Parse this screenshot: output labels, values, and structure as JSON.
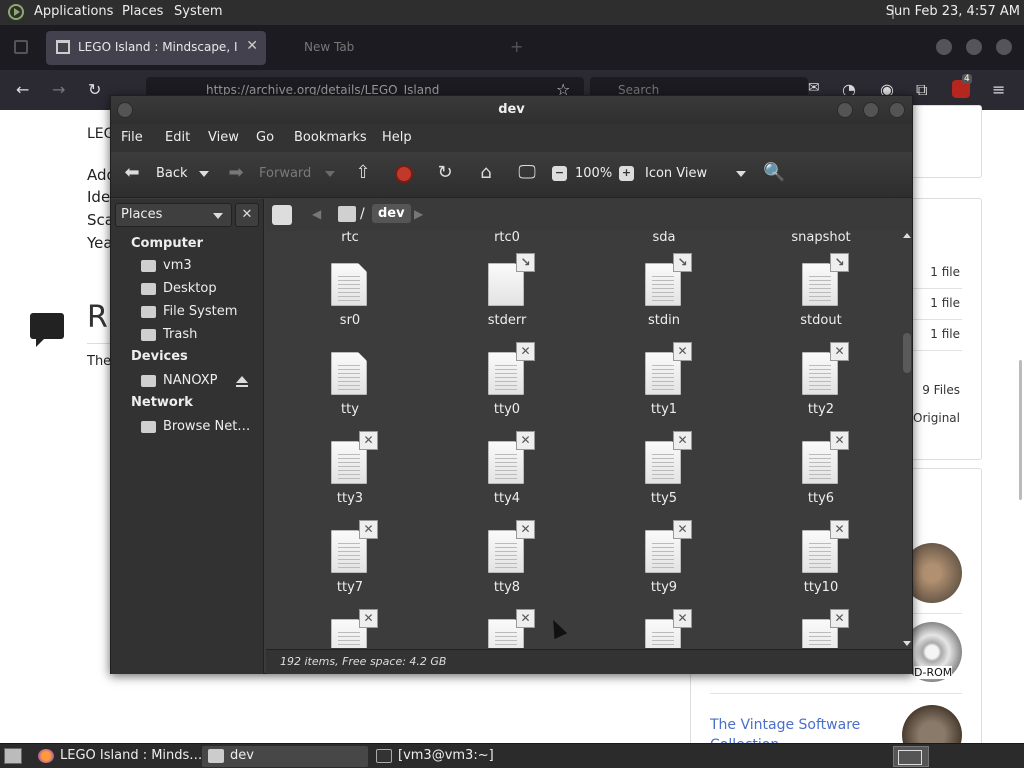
{
  "top_panel": {
    "menus": [
      "Applications",
      "Places",
      "System"
    ],
    "clock": "Sun Feb 23,  4:57 AM"
  },
  "browser": {
    "active_tab_title": "LEGO Island : Mindscape, In",
    "ghost_tab_title": "New Tab",
    "url": "https://archive.org/details/LEGO_Island",
    "search_placeholder": "Search",
    "extension_badge": "4",
    "page_left_texts": [
      "LEGO",
      "Add",
      "Ide",
      "Sca",
      "Yea"
    ],
    "page_heading_fragment": "R",
    "page_body_fragment": "The",
    "file_counts": [
      "1 file",
      "1 file",
      "1 file",
      "9 Files"
    ],
    "original_label": "Original",
    "cd_label": "D-ROM",
    "vintage_link": "The Vintage Software Collection"
  },
  "file_manager": {
    "window_title": "dev",
    "menus": [
      "File",
      "Edit",
      "View",
      "Go",
      "Bookmarks",
      "Help"
    ],
    "toolbar": {
      "back": "Back",
      "forward": "Forward",
      "zoom": "100%",
      "view_mode": "Icon View"
    },
    "sidebar": {
      "places_label": "Places",
      "sections": [
        {
          "heading": "Computer",
          "items": [
            "vm3",
            "Desktop",
            "File System",
            "Trash"
          ]
        },
        {
          "heading": "Devices",
          "items": [
            "NANOXP"
          ]
        },
        {
          "heading": "Network",
          "items": [
            "Browse Net…"
          ]
        }
      ]
    },
    "path": {
      "current": "dev",
      "separator": "/"
    },
    "top_row_names": [
      "rtc",
      "rtc0",
      "sda",
      "snapshot"
    ],
    "items": [
      {
        "name": "sr0",
        "emblem": ""
      },
      {
        "name": "stderr",
        "emblem": "link"
      },
      {
        "name": "stdin",
        "emblem": "link"
      },
      {
        "name": "stdout",
        "emblem": "link"
      },
      {
        "name": "tty",
        "emblem": ""
      },
      {
        "name": "tty0",
        "emblem": "x"
      },
      {
        "name": "tty1",
        "emblem": "x"
      },
      {
        "name": "tty2",
        "emblem": "x"
      },
      {
        "name": "tty3",
        "emblem": "x"
      },
      {
        "name": "tty4",
        "emblem": "x"
      },
      {
        "name": "tty5",
        "emblem": "x"
      },
      {
        "name": "tty6",
        "emblem": "x"
      },
      {
        "name": "tty7",
        "emblem": "x"
      },
      {
        "name": "tty8",
        "emblem": "x"
      },
      {
        "name": "tty9",
        "emblem": "x"
      },
      {
        "name": "tty10",
        "emblem": "x"
      },
      {
        "name": "",
        "emblem": "x"
      },
      {
        "name": "",
        "emblem": "x"
      },
      {
        "name": "",
        "emblem": "x"
      },
      {
        "name": "",
        "emblem": "x"
      }
    ],
    "status": "192 items, Free space: 4.2 GB"
  },
  "taskbar": {
    "tasks": [
      "LEGO Island : Minds…",
      "dev",
      "[vm3@vm3:~]"
    ]
  }
}
